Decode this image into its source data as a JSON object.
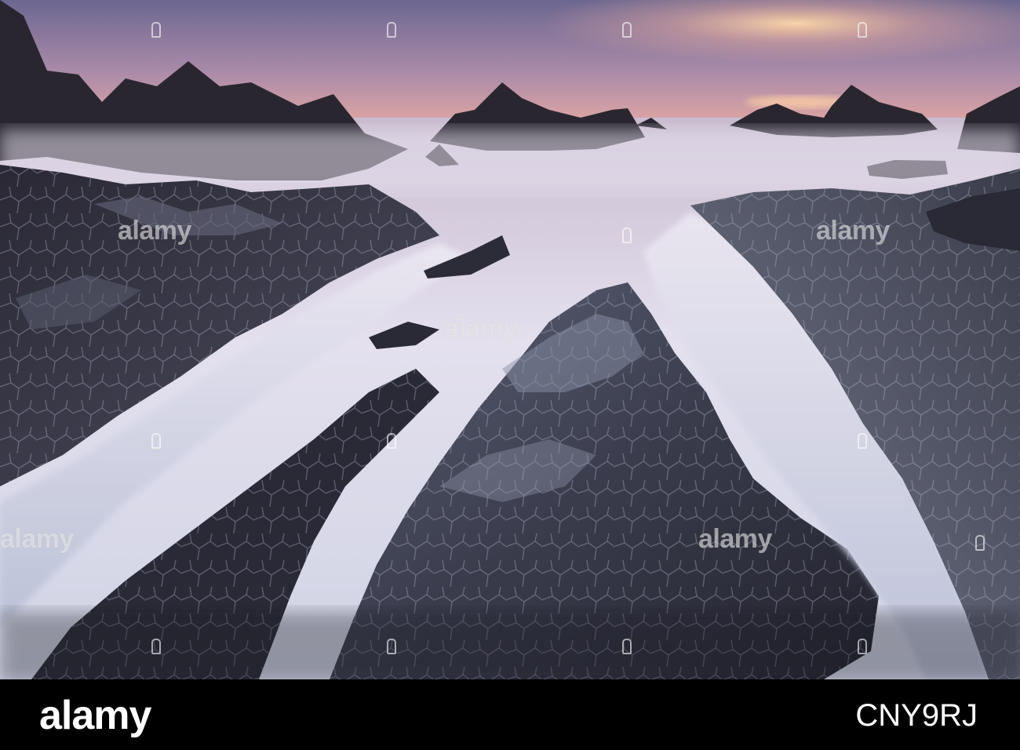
{
  "photo": {
    "subject": "long-exposure seascape with jagged rocks",
    "colors": {
      "sky_top": "#6e6a8e",
      "sky_mid": "#b48aa6",
      "sky_glow": "#f2b8a0",
      "sea_mist": "#dcdcec",
      "rock_dark": "#1c1c24",
      "rock_light": "#8a8ea2"
    }
  },
  "watermark": {
    "text": "alamy"
  },
  "footer": {
    "logo": "alamy",
    "image_id": "CNY9RJ",
    "background": "#000000"
  }
}
